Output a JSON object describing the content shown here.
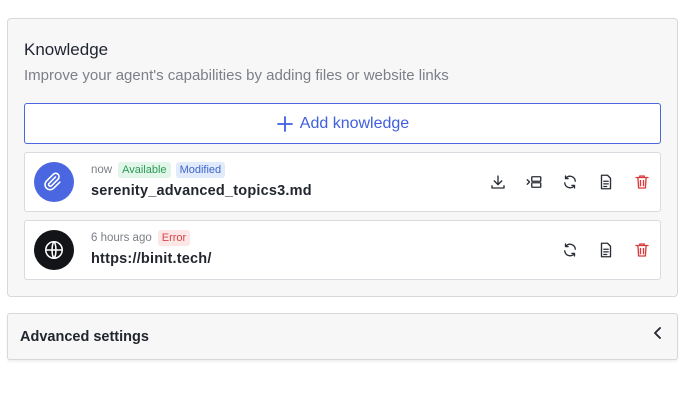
{
  "knowledge": {
    "title": "Knowledge",
    "subtitle": "Improve your agent's capabilities by adding files or website links",
    "add_label": "Add knowledge",
    "items": [
      {
        "type": "file",
        "icon": "paperclip-icon",
        "time": "now",
        "badges": [
          "Available",
          "Modified"
        ],
        "name": "serenity_advanced_topics3.md",
        "actions": [
          "download-icon",
          "move-icon",
          "refresh-icon",
          "document-icon",
          "trash-icon"
        ]
      },
      {
        "type": "website",
        "icon": "globe-icon",
        "time": "6 hours ago",
        "badges": [
          "Error"
        ],
        "name": "https://binit.tech/",
        "actions": [
          "refresh-icon",
          "document-icon",
          "trash-icon"
        ]
      }
    ]
  },
  "advanced": {
    "label": "Advanced settings",
    "icon": "chevron-left-icon"
  },
  "colors": {
    "accent": "#4a66e0",
    "available": "#2b9a56",
    "modified": "#3f66c9",
    "error": "#d64545",
    "danger": "#d93a3a"
  }
}
